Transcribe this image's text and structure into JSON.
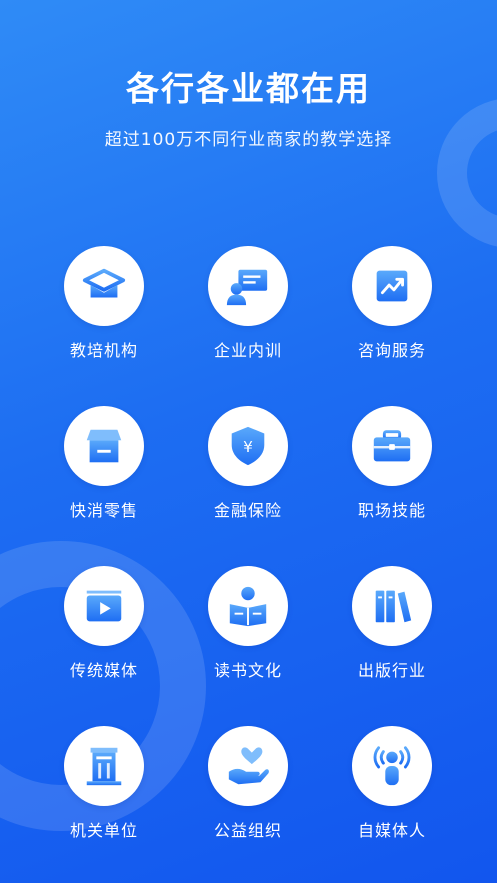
{
  "header": {
    "title": "各行各业都在用",
    "subtitle": "超过100万不同行业商家的教学选择"
  },
  "colors": {
    "accent": "#1e6ef3",
    "accent_light": "#5aa9fb"
  },
  "industries": [
    {
      "label": "教培机构",
      "icon": "graduation-cap-icon"
    },
    {
      "label": "企业内训",
      "icon": "presenter-board-icon"
    },
    {
      "label": "咨询服务",
      "icon": "trend-chart-icon"
    },
    {
      "label": "快消零售",
      "icon": "storefront-icon"
    },
    {
      "label": "金融保险",
      "icon": "shield-yuan-icon"
    },
    {
      "label": "职场技能",
      "icon": "briefcase-icon"
    },
    {
      "label": "传统媒体",
      "icon": "video-play-icon"
    },
    {
      "label": "读书文化",
      "icon": "person-reading-icon"
    },
    {
      "label": "出版行业",
      "icon": "books-icon"
    },
    {
      "label": "机关单位",
      "icon": "government-building-icon"
    },
    {
      "label": "公益组织",
      "icon": "heart-hand-icon"
    },
    {
      "label": "自媒体人",
      "icon": "broadcaster-icon"
    }
  ]
}
